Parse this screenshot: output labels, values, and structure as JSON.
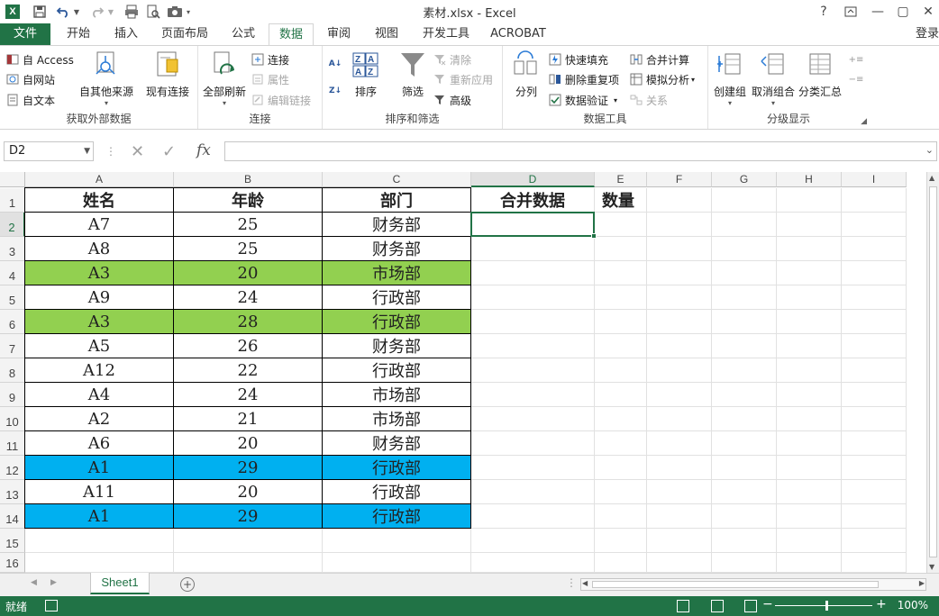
{
  "window": {
    "title": "素材.xlsx - Excel",
    "help": "?",
    "minimize": "—",
    "restore": "▢",
    "close": "✕"
  },
  "qat": {
    "logo": "X"
  },
  "tabs": [
    {
      "label": "文件"
    },
    {
      "label": "开始"
    },
    {
      "label": "插入"
    },
    {
      "label": "页面布局"
    },
    {
      "label": "公式"
    },
    {
      "label": "数据"
    },
    {
      "label": "审阅"
    },
    {
      "label": "视图"
    },
    {
      "label": "开发工具"
    },
    {
      "label": "ACROBAT"
    }
  ],
  "login": "登录",
  "ribbon": {
    "get_external": {
      "label": "获取外部数据",
      "access": "自 Access",
      "web": "自网站",
      "text": "自文本",
      "other": "自其他来源",
      "existing": "现有连接"
    },
    "connections": {
      "label": "连接",
      "refresh_all": "全部刷新",
      "connect": "连接",
      "properties": "属性",
      "edit_links": "编辑链接"
    },
    "sort_filter": {
      "label": "排序和筛选",
      "sort": "排序",
      "filter": "筛选",
      "clear": "清除",
      "reapply": "重新应用",
      "advanced": "高级"
    },
    "data_tools": {
      "label": "数据工具",
      "split": "分列",
      "flash_fill": "快速填充",
      "remove_dup": "删除重复项",
      "validation": "数据验证",
      "consolidate": "合并计算",
      "what_if": "模拟分析",
      "relations": "关系"
    },
    "outline": {
      "label": "分级显示",
      "group": "创建组",
      "ungroup": "取消组合",
      "subtotal": "分类汇总"
    }
  },
  "formula_bar": {
    "name_box": "D2",
    "formula": "",
    "fx": "fx"
  },
  "columns": [
    "A",
    "B",
    "C",
    "D",
    "E",
    "F",
    "G",
    "H",
    "I"
  ],
  "rows": [
    "1",
    "2",
    "3",
    "4",
    "5",
    "6",
    "7",
    "8",
    "9",
    "10",
    "11",
    "12",
    "13",
    "14",
    "15",
    "16"
  ],
  "header_row": [
    "姓名",
    "年龄",
    "部门",
    "合并数据",
    "数量"
  ],
  "table": [
    {
      "name": "A7",
      "age": "25",
      "dept": "财务部",
      "fill": "none"
    },
    {
      "name": "A8",
      "age": "25",
      "dept": "财务部",
      "fill": "none"
    },
    {
      "name": "A3",
      "age": "20",
      "dept": "市场部",
      "fill": "green"
    },
    {
      "name": "A9",
      "age": "24",
      "dept": "行政部",
      "fill": "none"
    },
    {
      "name": "A3",
      "age": "28",
      "dept": "行政部",
      "fill": "green"
    },
    {
      "name": "A5",
      "age": "26",
      "dept": "财务部",
      "fill": "none"
    },
    {
      "name": "A12",
      "age": "22",
      "dept": "行政部",
      "fill": "none"
    },
    {
      "name": "A4",
      "age": "24",
      "dept": "市场部",
      "fill": "none"
    },
    {
      "name": "A2",
      "age": "21",
      "dept": "市场部",
      "fill": "none"
    },
    {
      "name": "A6",
      "age": "20",
      "dept": "财务部",
      "fill": "none"
    },
    {
      "name": "A1",
      "age": "29",
      "dept": "行政部",
      "fill": "blue"
    },
    {
      "name": "A11",
      "age": "20",
      "dept": "行政部",
      "fill": "none"
    },
    {
      "name": "A1",
      "age": "29",
      "dept": "行政部",
      "fill": "blue"
    }
  ],
  "selected_cell": "D2",
  "colors": {
    "excel_green": "#217346",
    "fill_green": "#92d050",
    "fill_blue": "#00b0f0"
  },
  "sheet_tabs": [
    {
      "label": "Sheet1"
    }
  ],
  "add_sheet": "+",
  "status": {
    "text": "就绪",
    "zoom": "100%",
    "minus": "−",
    "plus": "+"
  }
}
